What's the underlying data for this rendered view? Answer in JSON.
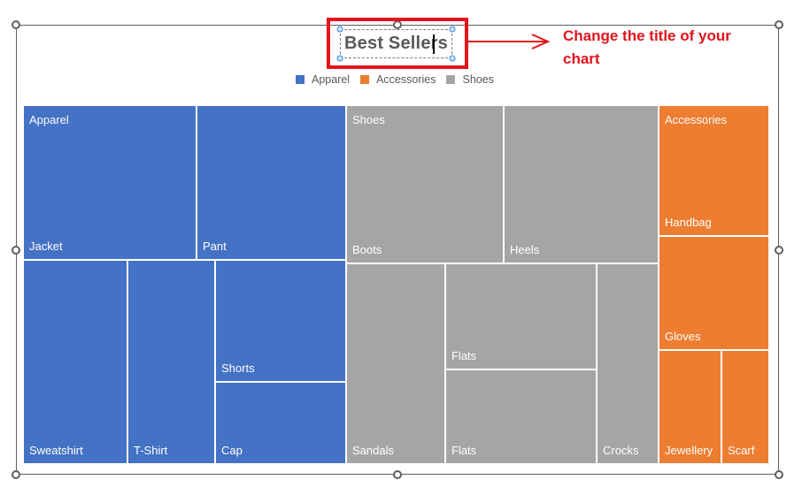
{
  "chart_data": {
    "type": "treemap",
    "title": "Best Sellers",
    "legend": {
      "position": "top",
      "entries": [
        {
          "name": "Apparel",
          "color": "#4472c4"
        },
        {
          "name": "Accessories",
          "color": "#ed7d31"
        },
        {
          "name": "Shoes",
          "color": "#a5a5a5"
        }
      ]
    },
    "groups": [
      {
        "name": "Apparel",
        "color": "#4472c4",
        "items": [
          {
            "name": "Jacket",
            "value": 35
          },
          {
            "name": "Pant",
            "value": 30
          },
          {
            "name": "Sweatshirt",
            "value": 26
          },
          {
            "name": "T-Shirt",
            "value": 22
          },
          {
            "name": "Shorts",
            "value": 20
          },
          {
            "name": "Cap",
            "value": 13
          }
        ]
      },
      {
        "name": "Shoes",
        "color": "#a5a5a5",
        "items": [
          {
            "name": "Boots",
            "value": 32
          },
          {
            "name": "Heels",
            "value": 31
          },
          {
            "name": "Sandals",
            "value": 23
          },
          {
            "name": "Flats",
            "value": 20
          },
          {
            "name": "Flats",
            "value": 18
          },
          {
            "name": "Crocks",
            "value": 14
          }
        ]
      },
      {
        "name": "Accessories",
        "color": "#ed7d31",
        "items": [
          {
            "name": "Handbag",
            "value": 18
          },
          {
            "name": "Gloves",
            "value": 16
          },
          {
            "name": "Jewellery",
            "value": 9
          },
          {
            "name": "Scarf",
            "value": 7
          }
        ]
      }
    ]
  },
  "annotation": {
    "text": "Change the title of your chart",
    "color": "#e3121b"
  },
  "title_edit": {
    "text": "Best Sellers",
    "editing": true
  }
}
